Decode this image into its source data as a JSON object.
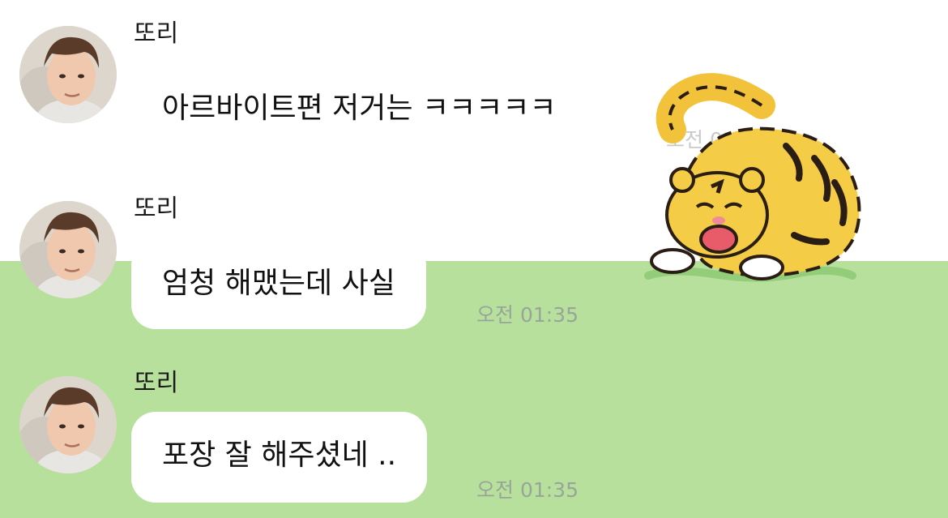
{
  "messages": [
    {
      "sender": "또리",
      "text": "아르바이트편 저거는 ㅋㅋㅋㅋㅋ",
      "time": "오전 01:35"
    },
    {
      "sender": "또리",
      "text": "엄청 해맸는데 사실",
      "time": "오전 01:35"
    },
    {
      "sender": "또리",
      "text": "포장 잘 해주셨네 ..",
      "time": "오전 01:35"
    }
  ],
  "colors": {
    "top_background": "#ffffff",
    "chat_background": "#b6e09c",
    "bubble": "#ffffff",
    "timestamp": "#9aa59a"
  },
  "icons": {
    "avatar": "profile-photo",
    "sticker": "tiger-sticker"
  }
}
